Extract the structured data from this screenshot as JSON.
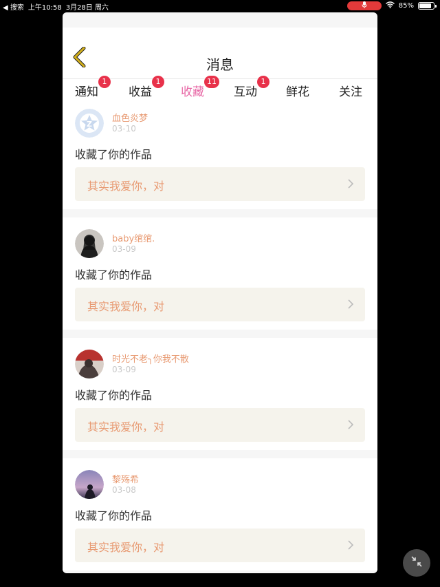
{
  "status_bar": {
    "back_label": "◀ 搜索",
    "time": "上午10:58",
    "date": "3月28日 周六",
    "battery": "85%",
    "battery_level": 0.85
  },
  "header": {
    "title": "消息"
  },
  "tabs": [
    {
      "label": "通知",
      "badge": "1"
    },
    {
      "label": "收益",
      "badge": "1"
    },
    {
      "label": "收藏",
      "badge": "11",
      "active": true
    },
    {
      "label": "互动",
      "badge": "1"
    },
    {
      "label": "鲜花",
      "badge": ""
    },
    {
      "label": "关注",
      "badge": ""
    }
  ],
  "messages": [
    {
      "username": "血色炎梦",
      "date": "03-10",
      "action": "收藏了你的作品",
      "work_title": "其实我爱你，对"
    },
    {
      "username": "baby绾绾.",
      "date": "03-09",
      "action": "收藏了你的作品",
      "work_title": "其实我爱你，对"
    },
    {
      "username": "时光不老╮你我不散",
      "date": "03-09",
      "action": "收藏了你的作品",
      "work_title": "其实我爱你，对"
    },
    {
      "username": "黎殇希",
      "date": "03-08",
      "action": "收藏了你的作品",
      "work_title": "其实我爱你，对"
    }
  ],
  "colors": {
    "accent_pink": "#e86aa7",
    "badge_red": "#e8314a",
    "username_orange": "#e89a72",
    "work_box_bg": "#f5f3ec",
    "back_arrow": "#d6b21c"
  }
}
